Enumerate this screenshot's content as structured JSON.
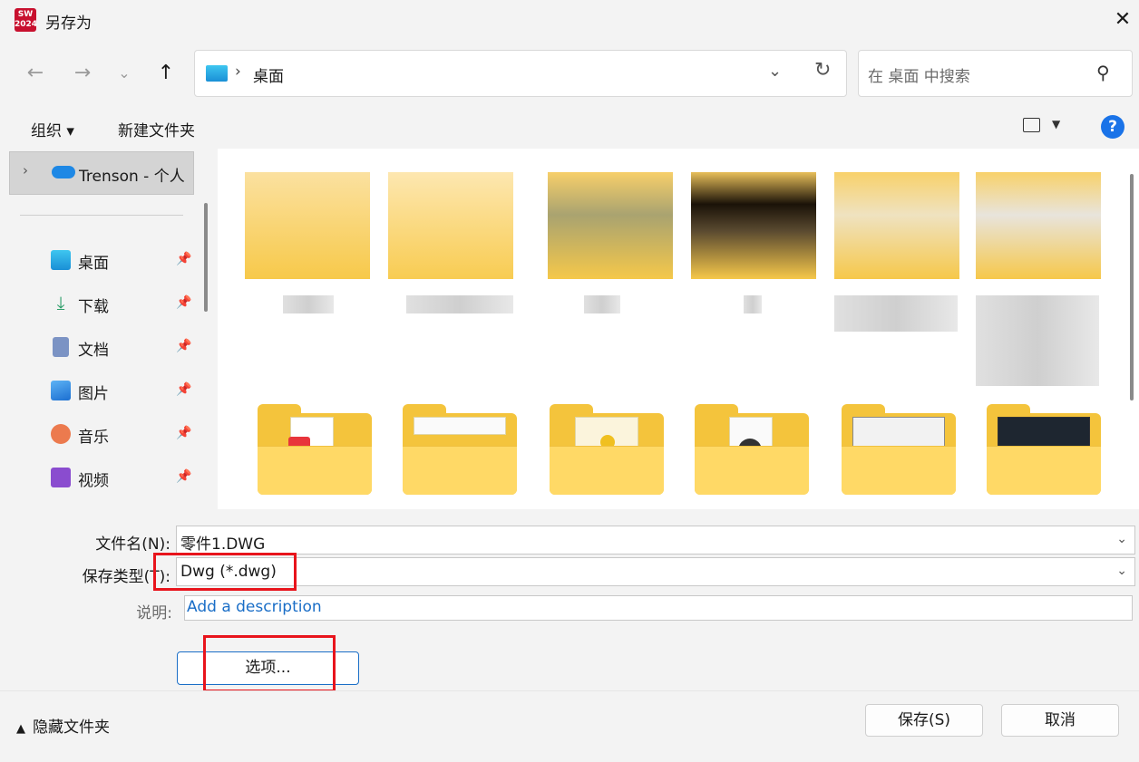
{
  "window": {
    "app_icon_text": "SW 2024",
    "title": "另存为"
  },
  "address_bar": {
    "location": "桌面"
  },
  "search": {
    "placeholder": "在 桌面 中搜索"
  },
  "toolbar": {
    "organize_label": "组织 ▾",
    "new_folder_label": "新建文件夹"
  },
  "sidebar": {
    "tree_root": "Trenson - 个人",
    "items": [
      {
        "label": "桌面",
        "icon": "desktop-icon",
        "color": "#29a8e6"
      },
      {
        "label": "下载",
        "icon": "download-icon",
        "color": "#2e9e6a"
      },
      {
        "label": "文档",
        "icon": "document-icon",
        "color": "#6b86b8"
      },
      {
        "label": "图片",
        "icon": "pictures-icon",
        "color": "#2b7de0"
      },
      {
        "label": "音乐",
        "icon": "music-icon",
        "color": "#e8704a"
      },
      {
        "label": "视频",
        "icon": "video-icon",
        "color": "#8a4ccf"
      }
    ]
  },
  "form": {
    "filename_label": "文件名(N):",
    "filename_value": "零件1.DWG",
    "type_label": "保存类型(T):",
    "type_value": "Dwg (*.dwg)",
    "description_label": "说明:",
    "description_value": "Add a description",
    "options_button": "选项..."
  },
  "footer": {
    "hide_folders_label": "隐藏文件夹",
    "save_button": "保存(S)",
    "cancel_button": "取消"
  }
}
